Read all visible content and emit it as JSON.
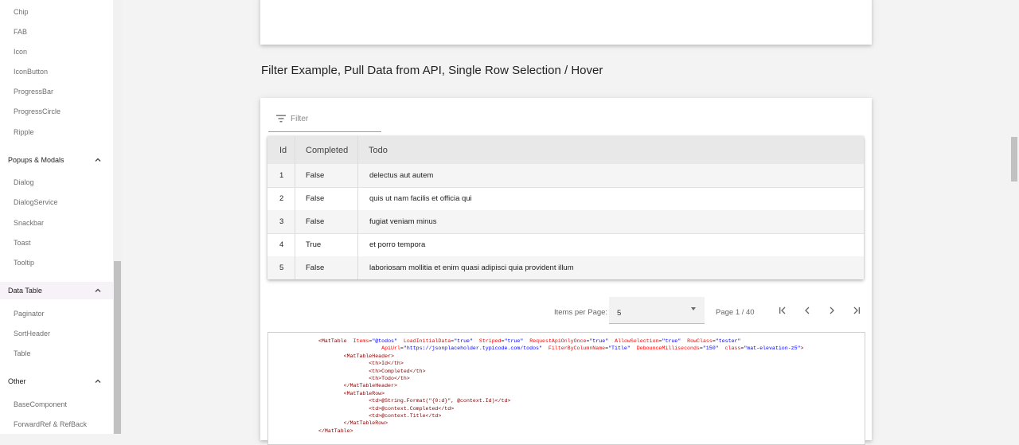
{
  "sidebar": {
    "items_top": [
      "Chip",
      "FAB",
      "Icon",
      "IconButton",
      "ProgressBar",
      "ProgressCircle",
      "Ripple"
    ],
    "groups": [
      {
        "label": "Popups & Modals",
        "items": [
          "Dialog",
          "DialogService",
          "Snackbar",
          "Toast",
          "Tooltip"
        ]
      },
      {
        "label": "Data Table",
        "items": [
          "Paginator",
          "SortHeader",
          "Table"
        ]
      },
      {
        "label": "Other",
        "items": [
          "BaseComponent",
          "ForwardRef & RefBack"
        ]
      }
    ]
  },
  "main": {
    "section_title": "Filter Example, Pull Data from API, Single Row Selection / Hover",
    "filter": {
      "placeholder": "Filter",
      "icon": "filter-list-icon"
    },
    "table": {
      "columns": [
        "Id",
        "Completed",
        "Todo"
      ],
      "rows": [
        [
          "1",
          "False",
          "delectus aut autem"
        ],
        [
          "2",
          "False",
          "quis ut nam facilis et officia qui"
        ],
        [
          "3",
          "False",
          "fugiat veniam minus"
        ],
        [
          "4",
          "True",
          "et porro tempora"
        ],
        [
          "5",
          "False",
          "laboriosam mollitia et enim quasi adipisci quia provident illum"
        ]
      ]
    },
    "paginator": {
      "items_per_page_label": "Items per Page:",
      "items_per_page_value": "5",
      "page_text": "Page 1 / 40"
    },
    "code": {
      "l1_tag": "<MatTable",
      "l1_attrs": [
        [
          "Items",
          "\"@todos\""
        ],
        [
          "LoadInitialData",
          "\"true\""
        ],
        [
          "Striped",
          "\"true\""
        ],
        [
          "RequestApiOnlyOnce",
          "\"true\""
        ],
        [
          "AllowSelection",
          "\"true\""
        ],
        [
          "RowClass",
          "\"tester\""
        ]
      ],
      "l2_attrs": [
        [
          "ApiUrl",
          "\"https://jsonplaceholder.typicode.com/todos\""
        ],
        [
          "FilterByColumnName",
          "\"Title\""
        ],
        [
          "DebounceMilliseconds",
          "\"150\""
        ],
        [
          "class",
          "\"mat-elevation-z5\""
        ]
      ],
      "l2_end": ">",
      "lines": [
        "        <MatTableHeader>",
        "                <th>Id</th>",
        "                <th>Completed</th>",
        "                <th>Todo</th>",
        "        </MatTableHeader>",
        "        <MatTableRow>",
        "                <td>@String.Format(\"{0:d}\", @context.Id)</td>",
        "                <td>@context.Completed</td>",
        "                <td>@context.Title</td>",
        "        </MatTableRow>",
        "</MatTable>"
      ]
    }
  }
}
